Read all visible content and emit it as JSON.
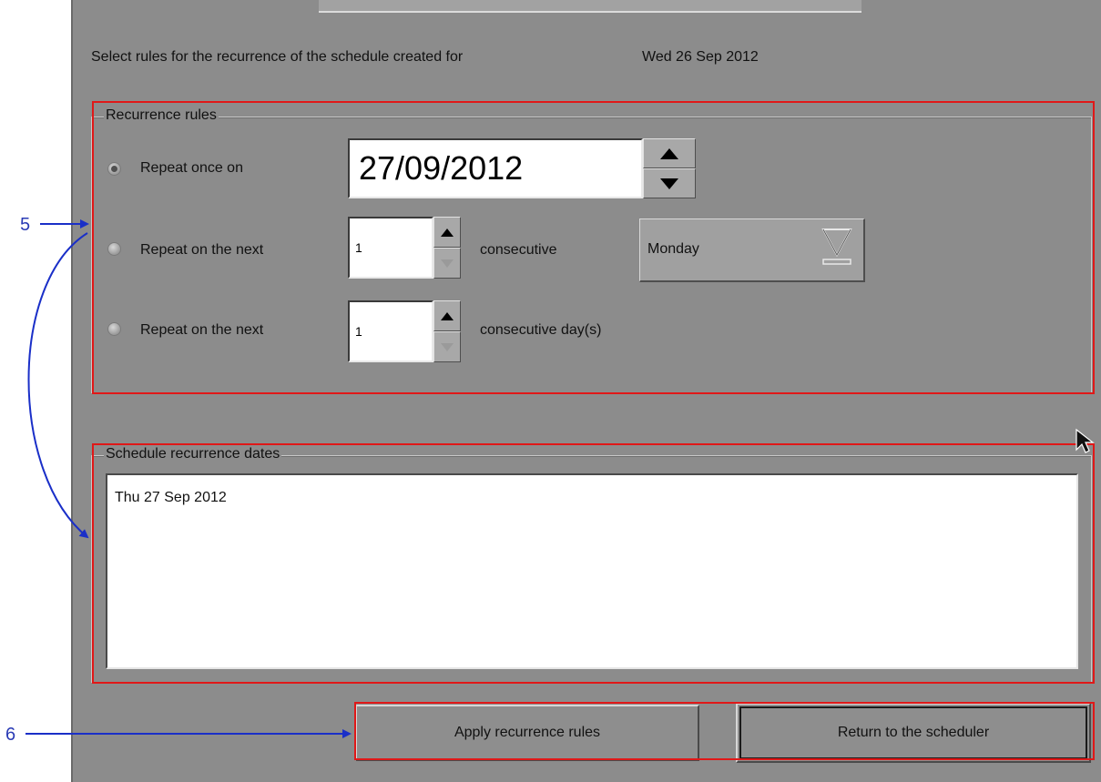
{
  "header": {
    "prompt": "Select rules for the recurrence of the schedule created for",
    "date": "Wed 26 Sep 2012"
  },
  "recurrence_rules": {
    "legend": "Recurrence rules",
    "rule_once": {
      "label": "Repeat once on",
      "value": "27/09/2012",
      "selected": true
    },
    "rule_weekday": {
      "label": "Repeat on the next",
      "count": "1",
      "suffix": "consecutive",
      "weekday": "Monday",
      "selected": false
    },
    "rule_days": {
      "label": "Repeat on the next",
      "count": "1",
      "suffix": "consecutive day(s)",
      "selected": false
    }
  },
  "recurrence_dates": {
    "legend": "Schedule recurrence dates",
    "items": [
      "Thu 27 Sep 2012"
    ]
  },
  "buttons": {
    "apply": "Apply recurrence rules",
    "return": "Return to the scheduler"
  },
  "callouts": {
    "five": "5",
    "six": "6"
  },
  "colors": {
    "panel": "#8c8c8c",
    "highlight_box": "#e01818",
    "callout_arrow": "#1a2fc8"
  },
  "icons": [
    "spin-up-icon",
    "spin-down-icon",
    "dropdown-caret-icon",
    "mouse-pointer-icon",
    "callout-arrow-icon"
  ]
}
